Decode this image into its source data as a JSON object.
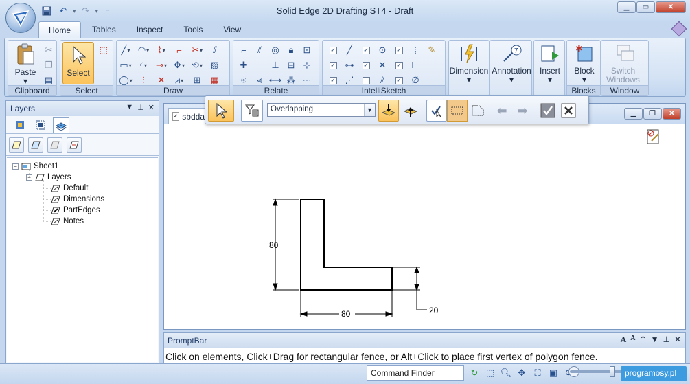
{
  "window": {
    "title": "Solid Edge 2D Drafting ST4 - Draft"
  },
  "ribbon": {
    "tabs": [
      "Home",
      "Tables",
      "Inspect",
      "Tools",
      "View"
    ],
    "groups": {
      "clipboard": {
        "label": "Clipboard",
        "paste": "Paste"
      },
      "select": {
        "label": "Select",
        "select": "Select"
      },
      "draw": {
        "label": "Draw"
      },
      "relate": {
        "label": "Relate"
      },
      "intellisketch": {
        "label": "IntelliSketch"
      },
      "dimension": {
        "label": "Dimension"
      },
      "annotation": {
        "label": "Annotation"
      },
      "insert": {
        "label": "Insert"
      },
      "blocks": {
        "label": "Blocks",
        "block": "Block"
      },
      "window": {
        "label": "Window",
        "switch": "Switch Windows"
      }
    }
  },
  "command_bar": {
    "selection_mode": "Overlapping"
  },
  "layers_pane": {
    "title": "Layers",
    "tree": {
      "sheet": "Sheet1",
      "layers_node": "Layers",
      "items": [
        "Default",
        "Dimensions",
        "PartEdges",
        "Notes"
      ]
    }
  },
  "document": {
    "tab_label": "sbdda"
  },
  "drawing": {
    "dim_height": "80",
    "dim_width": "80",
    "dim_thickness": "20"
  },
  "promptbar": {
    "title": "PromptBar",
    "message": "Click on elements, Click+Drag for rectangular fence, or Alt+Click to place first vertex of polygon fence."
  },
  "statusbar": {
    "command_finder": "Command Finder",
    "watermark": "programosy.pl"
  },
  "colors": {
    "accent": "#fbc35c",
    "frame": "#8ba6cc",
    "ribbon_bg": "#d3e2f4"
  }
}
